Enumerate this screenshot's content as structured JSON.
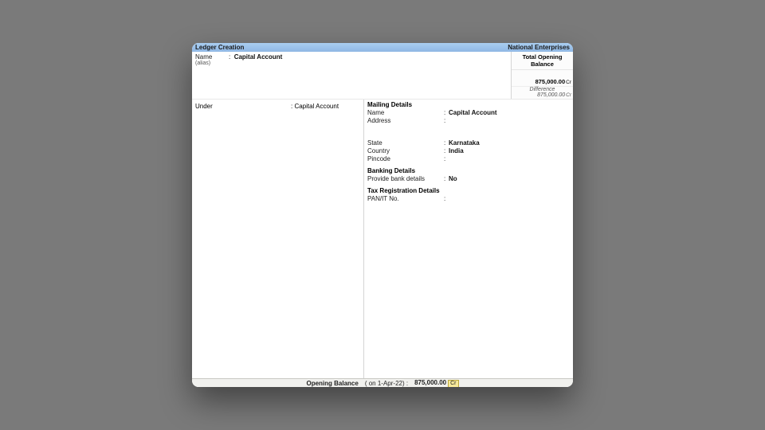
{
  "titlebar": {
    "left": "Ledger Creation",
    "right": "National Enterprises"
  },
  "header": {
    "name_label": "Name",
    "alias_label": "(alias)",
    "name_value": "Capital Account",
    "balance_header": "Total Opening Balance",
    "balance_amount": "875,000.00",
    "balance_drcr": "Cr",
    "difference_label": "Difference",
    "difference_amount": "875,000.00",
    "difference_drcr": "Cr"
  },
  "left": {
    "under_label": "Under",
    "under_value": "Capital Account"
  },
  "mailing": {
    "section": "Mailing Details",
    "name_label": "Name",
    "name_value": "Capital Account",
    "address_label": "Address",
    "address_value": "",
    "state_label": "State",
    "state_value": "Karnataka",
    "country_label": "Country",
    "country_value": "India",
    "pincode_label": "Pincode",
    "pincode_value": ""
  },
  "banking": {
    "section": "Banking Details",
    "provide_label": "Provide bank details",
    "provide_value": "No"
  },
  "tax": {
    "section": "Tax Registration Details",
    "pan_label": "PAN/IT No.",
    "pan_value": ""
  },
  "footer": {
    "label": "Opening Balance",
    "date": "( on 1-Apr-22)  :",
    "amount": "875,000.00",
    "drcr": "Cr"
  }
}
